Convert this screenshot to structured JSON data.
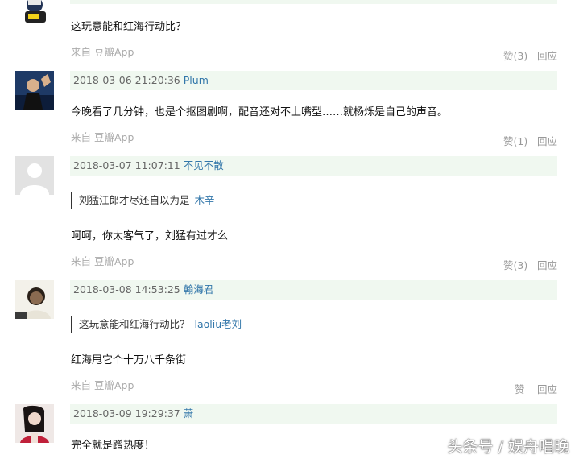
{
  "comments": [
    {
      "content": "这玩意能和红海行动比？",
      "source": "来自 豆瓣App",
      "likes": "赞(3)",
      "reply": "回应"
    },
    {
      "date": "2018-03-06 21:20:36",
      "user": "Plum",
      "content": "今晚看了几分钟，也是个抠图剧啊，配音还对不上嘴型……就杨烁是自己的声音。",
      "source": "来自 豆瓣App",
      "likes": "赞(1)",
      "reply": "回应"
    },
    {
      "date": "2018-03-07 11:07:11",
      "user": "不见不散",
      "quote": "刘猛江郎才尽还自以为是",
      "quote_author": "木辛",
      "content": "呵呵，你太客气了，刘猛有过才么",
      "source": "来自 豆瓣App",
      "likes": "赞(3)",
      "reply": "回应"
    },
    {
      "date": "2018-03-08 14:53:25",
      "user": "翰海君",
      "quote": "这玩意能和红海行动比？",
      "quote_author": "laoliu老刘",
      "content": "红海甩它个十万八千条街",
      "source": "来自 豆瓣App",
      "likes": "赞",
      "reply": "回应"
    },
    {
      "date": "2018-03-09 19:29:37",
      "user": "萧",
      "content": "完全就是蹭热度！"
    }
  ],
  "watermark": "头条号 / 娱舟唱晚"
}
